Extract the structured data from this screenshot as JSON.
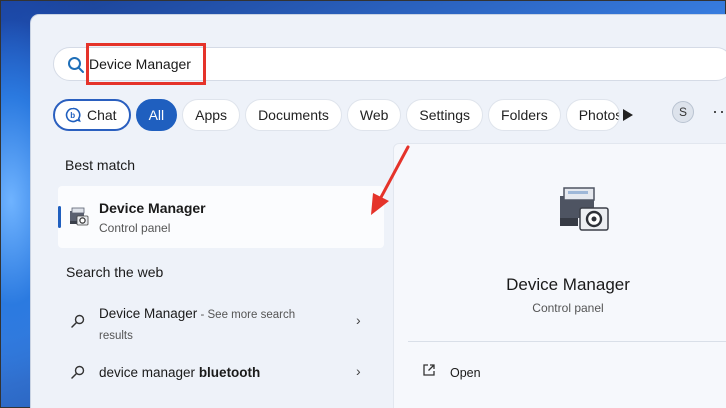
{
  "search": {
    "query": "Device Manager"
  },
  "chips": {
    "chat": "Chat",
    "all": "All",
    "apps": "Apps",
    "documents": "Documents",
    "web": "Web",
    "settings": "Settings",
    "folders": "Folders",
    "photos": "Photos"
  },
  "account": {
    "initial": "S"
  },
  "best_match": {
    "heading": "Best match",
    "title": "Device Manager",
    "subtitle": "Control panel"
  },
  "web_section": {
    "heading": "Search the web",
    "items": [
      {
        "text": "Device Manager",
        "suffix": " - See more search results"
      },
      {
        "text": "device manager ",
        "bold": "bluetooth"
      }
    ]
  },
  "detail": {
    "title": "Device Manager",
    "subtitle": "Control panel",
    "open_label": "Open"
  },
  "colors": {
    "accent": "#1f5fbf",
    "highlight": "#e5332a"
  },
  "icons": [
    "search-icon",
    "bing-chat-icon",
    "play-icon",
    "more-icon",
    "device-manager-icon",
    "web-search-icon",
    "chevron-right-icon",
    "open-external-icon"
  ]
}
